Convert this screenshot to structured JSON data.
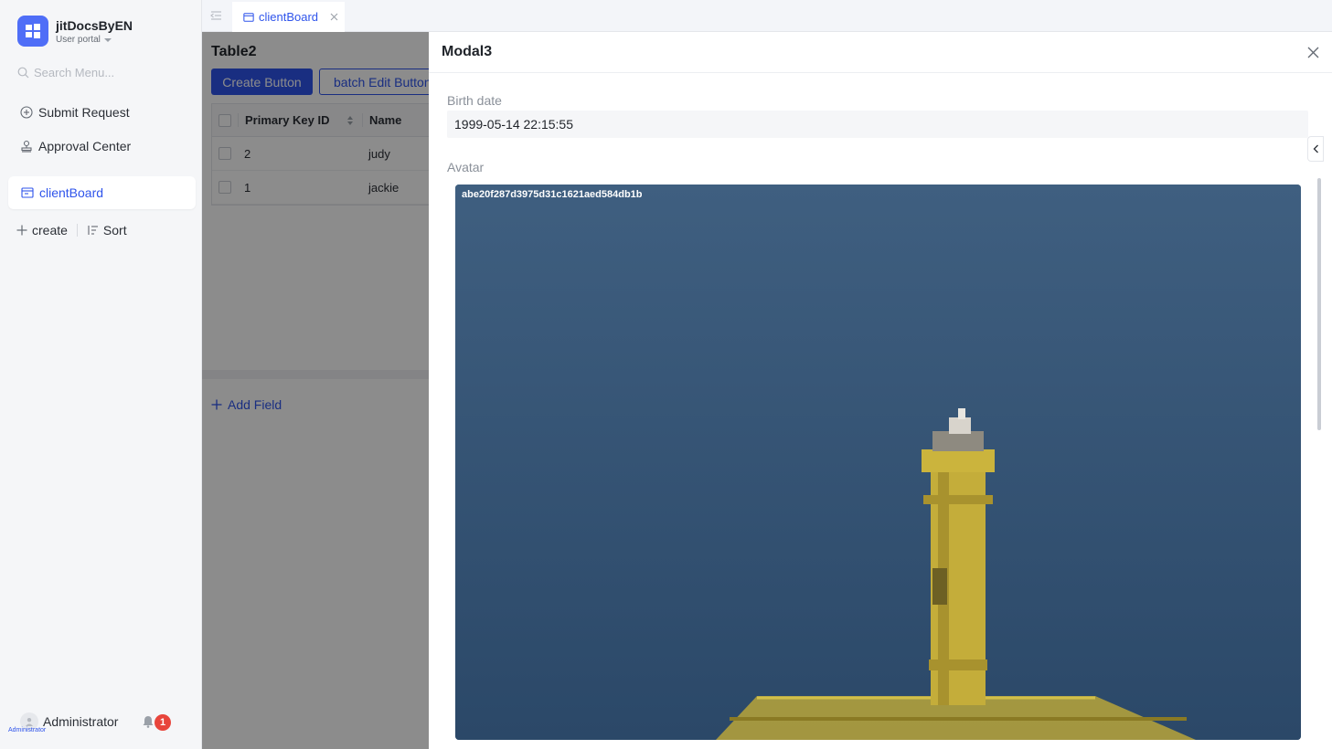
{
  "app": {
    "name": "jitDocsByEN",
    "portal": "User portal",
    "search_placeholder": "Search Menu..."
  },
  "sidebar": {
    "items": [
      {
        "label": "Submit Request",
        "icon": "plus-circle-icon"
      },
      {
        "label": "Approval Center",
        "icon": "stamp-icon"
      }
    ],
    "active_item": {
      "label": "clientBoard",
      "icon": "board-icon"
    },
    "create_label": "create",
    "sort_label": "Sort"
  },
  "user": {
    "name": "Administrator",
    "avatar_caption": "Administrator",
    "notifications": "1"
  },
  "tabs": [
    {
      "label": "clientBoard",
      "icon": "board-icon",
      "active": true
    }
  ],
  "table": {
    "title": "Table2",
    "create_button": "Create Button",
    "batch_button": "batch Edit Button",
    "columns": [
      "Primary Key ID",
      "Name"
    ],
    "rows": [
      {
        "id": "2",
        "name": "judy"
      },
      {
        "id": "1",
        "name": "jackie"
      }
    ],
    "add_field": "Add Field"
  },
  "modal": {
    "title": "Modal3",
    "birth_label": "Birth date",
    "birth_value": "1999-05-14 22:15:55",
    "avatar_label": "Avatar",
    "avatar_filename": "abe20f287d3975d31c1621aed584db1b"
  },
  "colors": {
    "accent": "#2f54eb",
    "badge": "#e8453c",
    "brand_logo": "#4f6ef7"
  }
}
